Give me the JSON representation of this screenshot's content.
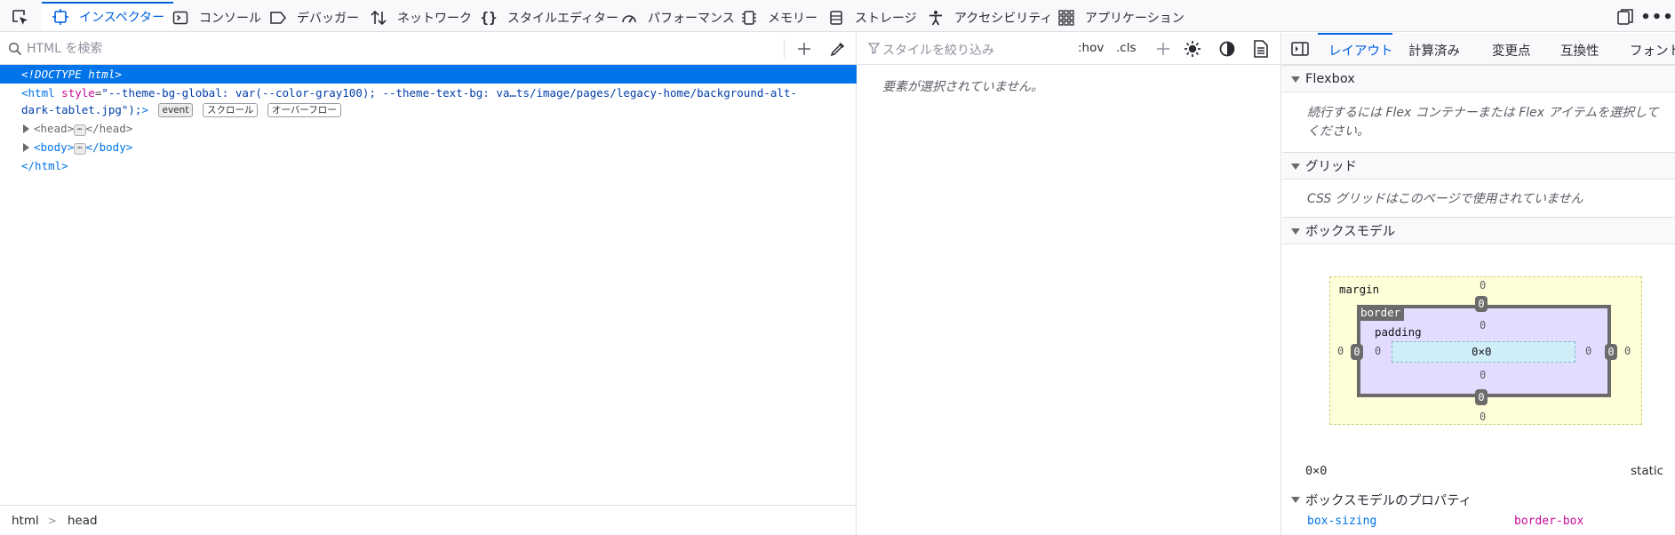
{
  "toolbar": {
    "tabs": [
      {
        "label": "インスペクター",
        "icon": "inspector-icon"
      },
      {
        "label": "コンソール",
        "icon": "console-icon"
      },
      {
        "label": "デバッガー",
        "icon": "debugger-icon"
      },
      {
        "label": "ネットワーク",
        "icon": "network-icon"
      },
      {
        "label": "スタイルエディター",
        "icon": "style-editor-icon"
      },
      {
        "label": "パフォーマンス",
        "icon": "performance-icon"
      },
      {
        "label": "メモリー",
        "icon": "memory-icon"
      },
      {
        "label": "ストレージ",
        "icon": "storage-icon"
      },
      {
        "label": "アクセシビリティ",
        "icon": "accessibility-icon"
      },
      {
        "label": "アプリケーション",
        "icon": "application-icon"
      }
    ],
    "active_tab": "インスペクター",
    "accent_color": "#0061e0"
  },
  "markup": {
    "search_placeholder": "HTML を検索",
    "doctype": "<!DOCTYPE html>",
    "html_open": "<html",
    "html_attr": "style",
    "html_attr_value_line1": "\"--theme-bg-global: var(--color-gray100); --theme-text-bg: va…ts/image/pages/legacy-home/background-alt-",
    "html_attr_value_line2": "dark-tablet.jpg\");",
    "html_close_angle": ">",
    "badges": [
      "event",
      "スクロール",
      "オーバーフロー"
    ],
    "head_open": "<head>",
    "head_close": "</head>",
    "body_open": "<body>",
    "body_close": "</body>",
    "html_close": "</html>",
    "ellipsis": "⋯",
    "selection_color": "#0074e8"
  },
  "breadcrumbs": [
    "html",
    "head"
  ],
  "rules": {
    "filter_placeholder": "スタイルを絞り込み",
    "hov": ":hov",
    "cls": ".cls",
    "no_element": "要素が選択されていません。"
  },
  "layout": {
    "tabs": [
      "レイアウト",
      "計算済み",
      "変更点",
      "互換性",
      "フォント"
    ],
    "active_tab": "レイアウト",
    "flexbox": {
      "title": "Flexbox",
      "note": "続行するには Flex コンテナーまたは Flex アイテムを選択してください。"
    },
    "grid": {
      "title": "グリッド",
      "note": "CSS グリッドはこのページで使用されていません"
    },
    "box_model": {
      "title": "ボックスモデル",
      "margin_label": "margin",
      "border_label": "border",
      "padding_label": "padding",
      "content": "0×0",
      "margin": {
        "top": "0",
        "right": "0",
        "bottom": "0",
        "left": "0"
      },
      "border": {
        "top": "0",
        "right": "0",
        "bottom": "0",
        "left": "0"
      },
      "padding": {
        "top": "0",
        "right": "0",
        "bottom": "0",
        "left": "0"
      },
      "size": "0×0",
      "position": "static"
    },
    "props": {
      "title": "ボックスモデルのプロパティ",
      "name": "box-sizing",
      "value": "border-box"
    }
  }
}
